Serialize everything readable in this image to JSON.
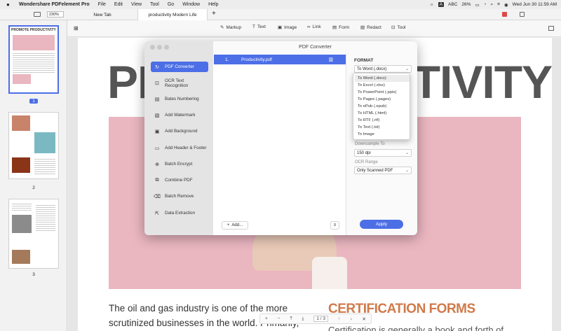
{
  "menubar": {
    "apple": "",
    "app_name": "Wondershare PDFelement Pro",
    "items": [
      "File",
      "Edit",
      "View",
      "Tool",
      "Go",
      "Window",
      "Help"
    ],
    "status": {
      "input": "ABC",
      "battery": "26%",
      "datetime": "Wed Jun 30  11:59 AM"
    }
  },
  "tabs": {
    "zoom": "230%",
    "tab1": "New Tab",
    "tab2": "productivity Modern Life",
    "add": "+"
  },
  "toolbar": {
    "markup": "Markup",
    "text": "Text",
    "image": "Image",
    "link": "Link",
    "form": "Form",
    "redact": "Redact",
    "tool": "Tool"
  },
  "sidebar": {
    "pages": [
      "1",
      "2",
      "3"
    ],
    "thumb1_title": "PROMOTE PRODUCTIVITY"
  },
  "document": {
    "title_left": "PR",
    "title_right": "TIVITY",
    "body": "The oil and gas industry is one of the more scrutinized businesses in the world. Primarily,",
    "cert_title": "CERTIFICATION FORMS",
    "cert_body": "Certification is generally a book and forth of"
  },
  "pager": {
    "current": "1",
    "sep": "/",
    "total": "3"
  },
  "dialog": {
    "title": "PDF Converter",
    "menu": [
      "PDF Converter",
      "OCR Text Recognition",
      "Bates Numbering",
      "Add Watermark",
      "Add Background",
      "Add Header & Footer",
      "Batch Encrypt",
      "Combine PDF",
      "Batch Remove",
      "Data Extraction"
    ],
    "file": {
      "index": "1.",
      "name": "Productivity.pdf"
    },
    "add_label": "Add...",
    "format_label": "FORMAT",
    "format_value": "To Word (.docx)",
    "downsample_label": "Downsample To",
    "downsample_value": "150 dpi",
    "ocr_label": "OCR Range",
    "ocr_value": "Only Scanned PDF",
    "apply_label": "Apply"
  },
  "dropdown": {
    "options": [
      "To Word (.docx)",
      "To Excel (.xlsx)",
      "To PowerPoint (.pptx)",
      "To Pages (.pages)",
      "To ePub (.epub)",
      "To HTML (.html)",
      "To RTF (.rtf)",
      "To Text (.txt)",
      "To Image"
    ],
    "highlighted": "To Word (.docx)"
  },
  "colors": {
    "accent": "#4c6ee6",
    "pink": "#eab6c0",
    "cert": "#d07a4a"
  }
}
